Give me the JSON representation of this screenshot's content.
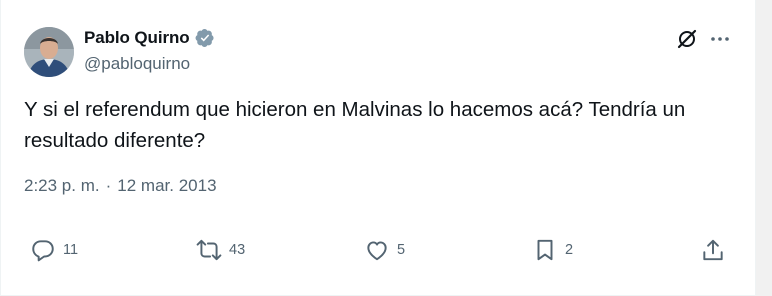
{
  "author": {
    "display_name": "Pablo Quirno",
    "handle": "@pabloquirno",
    "verified_badge_color": "#829aab"
  },
  "tweet": {
    "text": "Y si el referendum que hicieron en Malvinas lo hacemos acá? Tendría un resultado diferente?",
    "time": "2:23 p. m.",
    "separator": "·",
    "date": "12 mar. 2013"
  },
  "actions": {
    "replies": "11",
    "retweets": "43",
    "likes": "5",
    "bookmarks": "2"
  },
  "icons": {
    "header": [
      "grok-icon",
      "more-icon"
    ],
    "actions": [
      "reply-icon",
      "retweet-icon",
      "like-icon",
      "bookmark-icon",
      "share-icon"
    ]
  },
  "colors": {
    "text": "#0f1419",
    "secondary": "#536471"
  }
}
